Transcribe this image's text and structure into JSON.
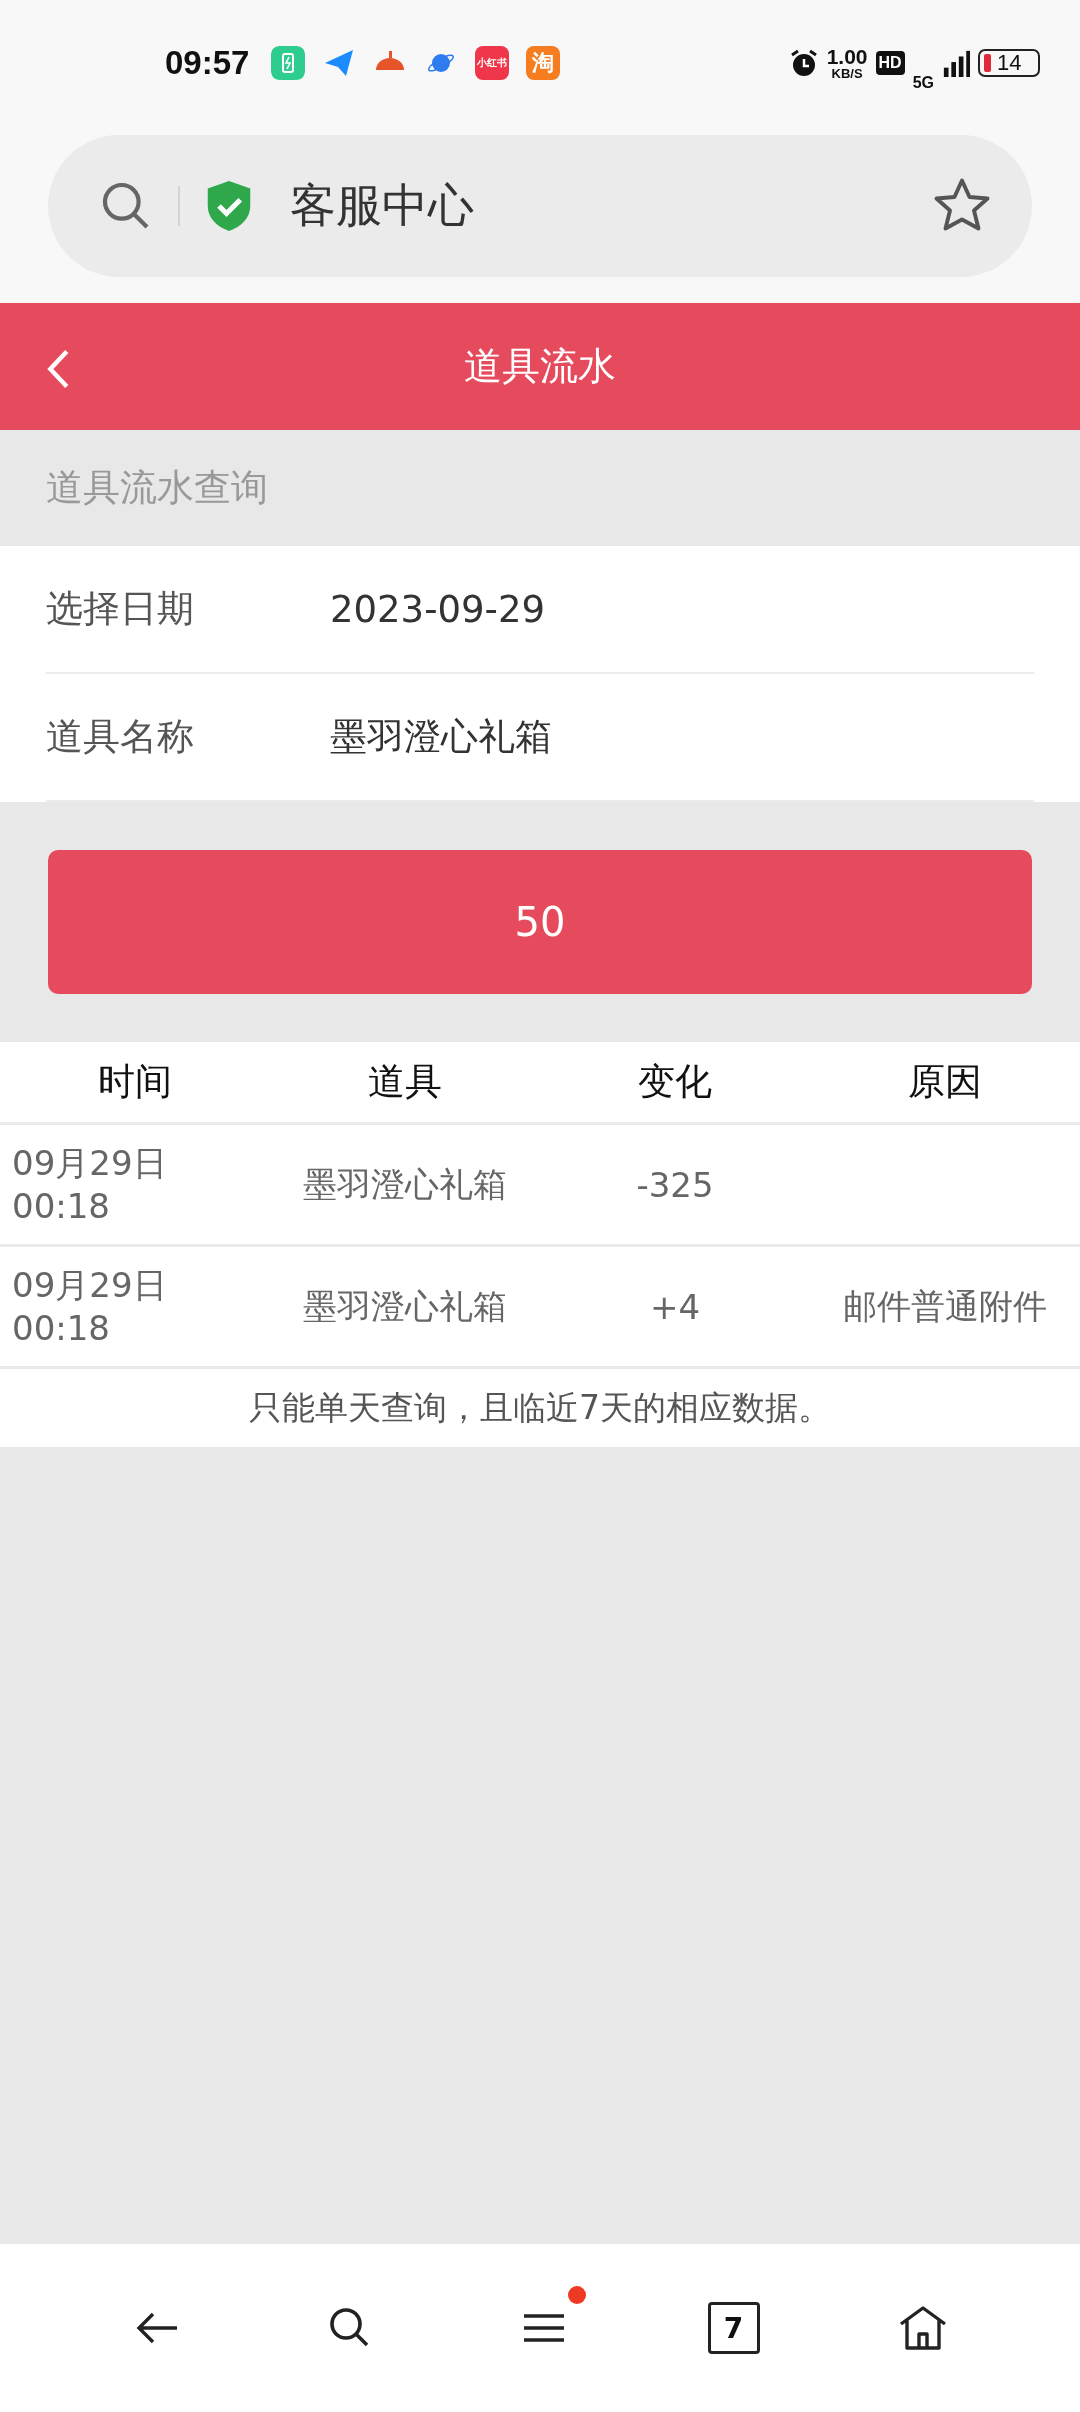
{
  "status_bar": {
    "time": "09:57",
    "apps": [
      {
        "kind": "battery",
        "color": "#2ecc8f"
      },
      {
        "kind": "plane",
        "color": "#1a8cff"
      },
      {
        "kind": "tomato",
        "color": "#e8542a"
      },
      {
        "kind": "planet",
        "color": "#2f7cf0"
      },
      {
        "kind": "text",
        "color": "#f0364a",
        "label": "小红书"
      },
      {
        "kind": "text",
        "color": "#f57c1f",
        "label": "淘"
      }
    ],
    "speed": "1.00",
    "speed_unit": "KB/S",
    "hd": "HD",
    "network": "5G",
    "battery": "14"
  },
  "address_bar": {
    "title": "客服中心"
  },
  "header": {
    "title": "道具流水"
  },
  "section_title": "道具流水查询",
  "form": [
    {
      "label": "选择日期",
      "value": "2023-09-29"
    },
    {
      "label": "道具名称",
      "value": "墨羽澄心礼箱"
    }
  ],
  "submit_button": "50",
  "table": {
    "columns": [
      "时间",
      "道具",
      "变化",
      "原因"
    ],
    "rows": [
      {
        "time": [
          "09月29日",
          "00:18"
        ],
        "item": "墨羽澄心礼箱",
        "change": "-325",
        "reason": ""
      },
      {
        "time": [
          "09月29日",
          "00:18"
        ],
        "item": "墨羽澄心礼箱",
        "change": "+4",
        "reason": "邮件普通附件"
      }
    ],
    "note": "只能单天查询，且临近7天的相应数据。"
  },
  "bottom_nav": {
    "tab_count": "7",
    "menu_badge": true
  }
}
